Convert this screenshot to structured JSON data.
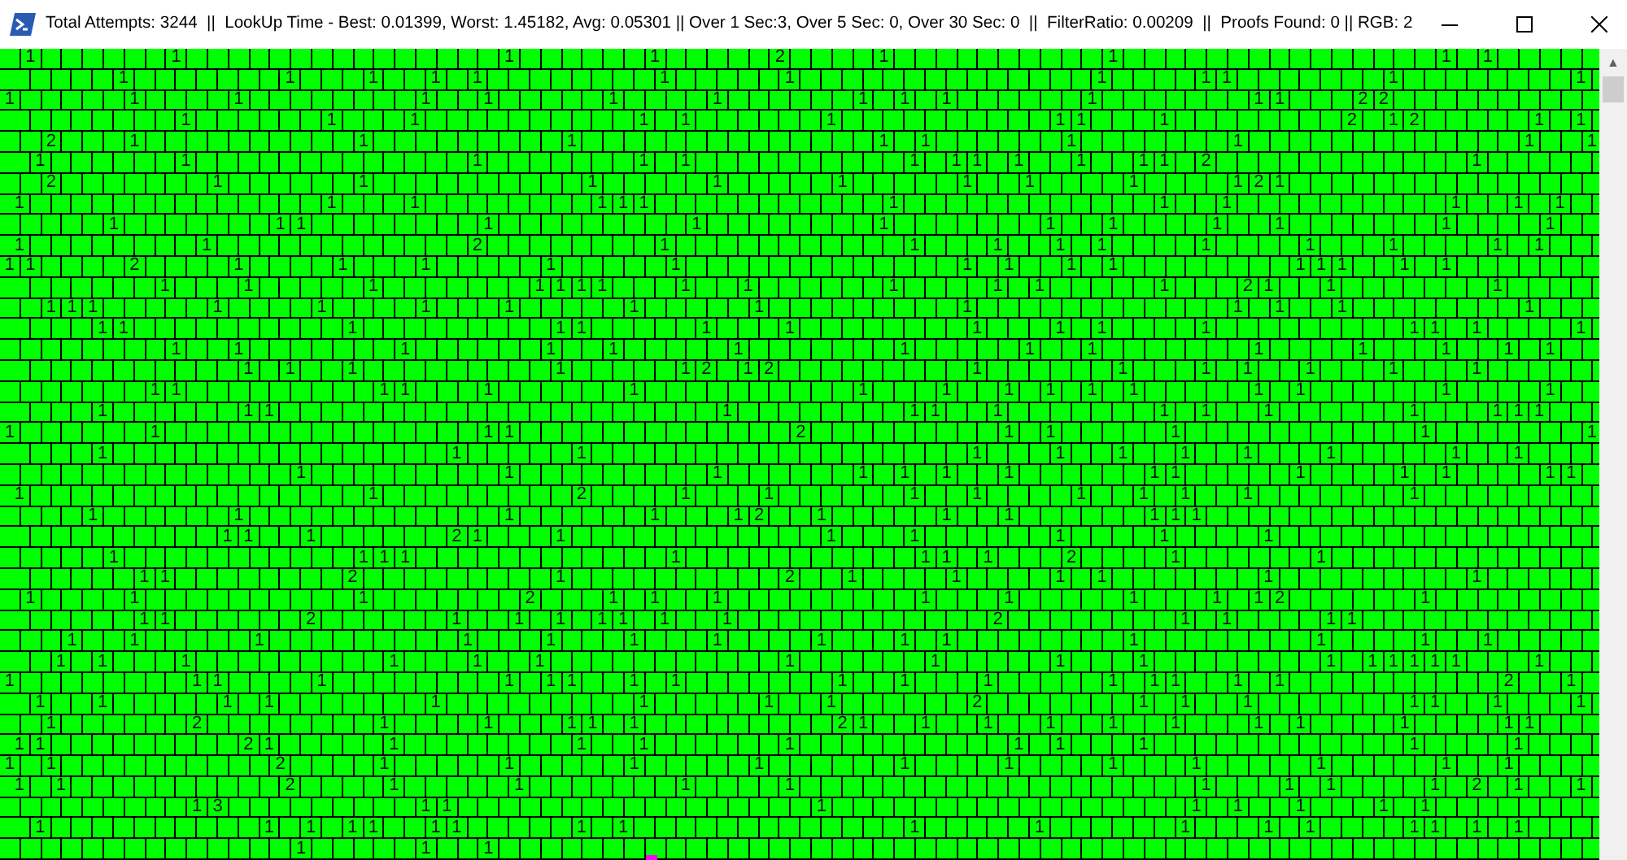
{
  "window": {
    "title": "Total Attempts: 3244  ||  LookUp Time - Best: 0.01399, Worst: 1.45182, Avg: 0.05301 || Over 1 Sec:3, Over 5 Sec: 0, Over 30 Sec: 0  ||  FilterRatio: 0.00209  ||  Proofs Found: 0 || RGB: 2"
  },
  "grid": {
    "rows": [
      [
        null,
        "1",
        null,
        null,
        null,
        null,
        null,
        null,
        "1",
        null,
        null,
        null,
        null,
        null,
        null,
        null,
        null,
        null,
        null,
        null,
        null,
        null,
        null,
        null,
        "1",
        null,
        null,
        null,
        null,
        null,
        null,
        "1",
        null,
        null,
        null,
        null,
        null,
        "2",
        null,
        null,
        null,
        null,
        "1",
        null,
        null,
        null,
        null,
        null,
        null,
        null,
        null,
        null,
        null,
        "1",
        null,
        null,
        null,
        null,
        null,
        null,
        null,
        null,
        null,
        null,
        null,
        null,
        null,
        null,
        null,
        "1",
        null,
        "1"
      ],
      [
        null,
        null,
        null,
        null,
        null,
        "1",
        null,
        null,
        null,
        null,
        null,
        null,
        null,
        "1",
        null,
        null,
        null,
        "1",
        null,
        null,
        "1",
        null,
        "1",
        null,
        null,
        null,
        null,
        null,
        null,
        null,
        null,
        "1",
        null,
        null,
        null,
        null,
        null,
        "1",
        null,
        null,
        null,
        null,
        null,
        null,
        null,
        null,
        null,
        null,
        null,
        null,
        null,
        null,
        "1",
        null,
        null,
        null,
        null,
        "1",
        "1",
        null,
        null,
        null,
        null,
        null,
        null,
        null,
        "1",
        null,
        null,
        null,
        null,
        null,
        null,
        null,
        null,
        "1"
      ],
      [
        "1",
        null,
        null,
        null,
        null,
        null,
        "1",
        null,
        null,
        null,
        null,
        "1",
        null,
        null,
        null,
        null,
        null,
        null,
        null,
        null,
        "1",
        null,
        null,
        "1",
        null,
        null,
        null,
        null,
        null,
        "1",
        null,
        null,
        null,
        null,
        "1",
        null,
        null,
        null,
        null,
        null,
        null,
        "1",
        null,
        "1",
        null,
        "1",
        null,
        null,
        null,
        null,
        null,
        null,
        "1",
        null,
        null,
        null,
        null,
        null,
        null,
        null,
        "1",
        "1",
        null,
        null,
        null,
        "2",
        "2"
      ],
      [
        null,
        null,
        null,
        null,
        null,
        null,
        null,
        null,
        "1",
        null,
        null,
        null,
        null,
        null,
        null,
        "1",
        null,
        null,
        null,
        "1",
        null,
        null,
        null,
        null,
        null,
        null,
        null,
        null,
        null,
        null,
        "1",
        null,
        "1",
        null,
        null,
        null,
        null,
        null,
        null,
        "1",
        null,
        null,
        null,
        null,
        null,
        null,
        null,
        null,
        null,
        null,
        "1",
        "1",
        null,
        null,
        null,
        "1",
        null,
        null,
        null,
        null,
        null,
        null,
        null,
        null,
        "2",
        null,
        "1",
        "2",
        null,
        null,
        null,
        null,
        null,
        "1",
        null,
        "1"
      ],
      [
        null,
        null,
        "2",
        null,
        null,
        null,
        "1",
        null,
        null,
        null,
        null,
        null,
        null,
        null,
        null,
        null,
        null,
        "1",
        null,
        null,
        null,
        null,
        null,
        null,
        null,
        null,
        null,
        "1",
        null,
        null,
        null,
        null,
        null,
        null,
        null,
        null,
        null,
        null,
        null,
        null,
        null,
        null,
        "1",
        null,
        "1",
        null,
        null,
        null,
        null,
        null,
        null,
        "1",
        null,
        null,
        null,
        null,
        null,
        null,
        null,
        "1",
        null,
        null,
        null,
        null,
        null,
        null,
        null,
        null,
        null,
        null,
        null,
        null,
        null,
        "1",
        null,
        null,
        "1"
      ],
      [
        null,
        "1",
        null,
        null,
        null,
        null,
        null,
        null,
        "1",
        null,
        null,
        null,
        null,
        null,
        null,
        null,
        null,
        null,
        null,
        null,
        null,
        null,
        "1",
        null,
        null,
        null,
        null,
        null,
        null,
        null,
        "1",
        null,
        "1",
        null,
        null,
        null,
        null,
        null,
        null,
        null,
        null,
        null,
        null,
        "1",
        null,
        "1",
        "1",
        null,
        "1",
        null,
        null,
        "1",
        null,
        null,
        "1",
        "1",
        null,
        "2",
        null,
        null,
        null,
        null,
        null,
        null,
        null,
        null,
        null,
        null,
        null,
        null,
        "1"
      ],
      [
        null,
        null,
        "2",
        null,
        null,
        null,
        null,
        null,
        null,
        null,
        "1",
        null,
        null,
        null,
        null,
        null,
        null,
        "1",
        null,
        null,
        null,
        null,
        null,
        null,
        null,
        null,
        null,
        null,
        "1",
        null,
        null,
        null,
        null,
        null,
        "1",
        null,
        null,
        null,
        null,
        null,
        "1",
        null,
        null,
        null,
        null,
        null,
        "1",
        null,
        null,
        "1",
        null,
        null,
        null,
        null,
        "1",
        null,
        null,
        null,
        null,
        "1",
        "2",
        "1"
      ],
      [
        "1",
        null,
        null,
        null,
        null,
        null,
        null,
        null,
        null,
        null,
        null,
        null,
        null,
        null,
        null,
        "1",
        null,
        null,
        null,
        "1",
        null,
        null,
        null,
        null,
        null,
        null,
        null,
        null,
        "1",
        "1",
        "1",
        null,
        null,
        null,
        null,
        null,
        null,
        null,
        null,
        null,
        null,
        null,
        "1",
        null,
        null,
        null,
        null,
        null,
        null,
        null,
        null,
        null,
        null,
        null,
        null,
        "1",
        null,
        null,
        "1",
        null,
        null,
        null,
        null,
        null,
        null,
        null,
        null,
        null,
        null,
        "1",
        null,
        null,
        "1",
        null,
        "1"
      ],
      [
        null,
        null,
        null,
        null,
        null,
        "1",
        null,
        null,
        null,
        null,
        null,
        null,
        null,
        "1",
        "1",
        null,
        null,
        null,
        null,
        null,
        null,
        null,
        null,
        "1",
        null,
        null,
        null,
        null,
        null,
        null,
        null,
        null,
        null,
        "1",
        null,
        null,
        null,
        null,
        null,
        null,
        null,
        null,
        "1",
        null,
        null,
        null,
        null,
        null,
        null,
        null,
        "1",
        null,
        null,
        "1",
        null,
        null,
        null,
        null,
        "1",
        null,
        null,
        "1",
        null,
        null,
        null,
        null,
        null,
        null,
        null,
        "1",
        null,
        null,
        null,
        null,
        "1"
      ],
      [
        "1",
        null,
        null,
        null,
        null,
        null,
        null,
        null,
        null,
        "1",
        null,
        null,
        null,
        null,
        null,
        null,
        null,
        null,
        null,
        null,
        null,
        null,
        "2",
        null,
        null,
        null,
        null,
        null,
        null,
        null,
        null,
        "1",
        null,
        null,
        null,
        null,
        null,
        null,
        null,
        null,
        null,
        null,
        null,
        "1",
        null,
        null,
        null,
        "1",
        null,
        null,
        "1",
        null,
        "1",
        null,
        null,
        null,
        null,
        "1",
        null,
        null,
        null,
        null,
        "1",
        null,
        null,
        null,
        "1",
        null,
        null,
        null,
        null,
        "1",
        null,
        "1"
      ],
      [
        "1",
        "1",
        null,
        null,
        null,
        null,
        "2",
        null,
        null,
        null,
        null,
        "1",
        null,
        null,
        null,
        null,
        "1",
        null,
        null,
        null,
        "1",
        null,
        null,
        null,
        null,
        null,
        "1",
        null,
        null,
        null,
        null,
        null,
        "1",
        null,
        null,
        null,
        null,
        null,
        null,
        null,
        null,
        null,
        null,
        null,
        null,
        null,
        "1",
        null,
        "1",
        null,
        null,
        "1",
        null,
        "1",
        null,
        null,
        null,
        null,
        null,
        null,
        null,
        null,
        "1",
        "1",
        "1",
        null,
        null,
        "1",
        null,
        "1"
      ],
      [
        null,
        null,
        null,
        null,
        null,
        null,
        null,
        "1",
        null,
        null,
        null,
        "1",
        null,
        null,
        null,
        null,
        null,
        "1",
        null,
        null,
        null,
        null,
        null,
        null,
        null,
        "1",
        "1",
        "1",
        "1",
        null,
        null,
        null,
        "1",
        null,
        null,
        "1",
        null,
        null,
        null,
        null,
        null,
        null,
        "1",
        null,
        null,
        null,
        null,
        "1",
        null,
        "1",
        null,
        null,
        null,
        null,
        null,
        "1",
        null,
        null,
        null,
        "2",
        "1",
        null,
        null,
        "1",
        null,
        null,
        null,
        null,
        null,
        null,
        null,
        "1"
      ],
      [
        null,
        null,
        "1",
        "1",
        "1",
        null,
        null,
        null,
        null,
        null,
        "1",
        null,
        null,
        null,
        null,
        "1",
        null,
        null,
        null,
        null,
        "1",
        null,
        null,
        null,
        "1",
        null,
        null,
        null,
        null,
        null,
        "1",
        null,
        null,
        null,
        null,
        null,
        "1",
        null,
        null,
        null,
        null,
        null,
        null,
        null,
        null,
        null,
        "1",
        null,
        null,
        null,
        null,
        null,
        null,
        null,
        null,
        null,
        null,
        null,
        null,
        "1",
        null,
        "1",
        null,
        null,
        "1",
        null,
        null,
        null,
        null,
        null,
        null,
        null,
        null,
        "1"
      ],
      [
        null,
        null,
        null,
        null,
        "1",
        "1",
        null,
        null,
        null,
        null,
        null,
        null,
        null,
        null,
        null,
        null,
        "1",
        null,
        null,
        null,
        null,
        null,
        null,
        null,
        null,
        null,
        "1",
        "1",
        null,
        null,
        null,
        null,
        null,
        "1",
        null,
        null,
        null,
        "1",
        null,
        null,
        null,
        null,
        null,
        null,
        null,
        null,
        "1",
        null,
        null,
        null,
        "1",
        null,
        "1",
        null,
        null,
        null,
        null,
        "1",
        null,
        null,
        null,
        null,
        null,
        null,
        null,
        null,
        null,
        "1",
        "1",
        null,
        "1",
        null,
        null,
        null,
        null,
        "1"
      ],
      [
        null,
        null,
        null,
        null,
        null,
        null,
        null,
        null,
        "1",
        null,
        null,
        "1",
        null,
        null,
        null,
        null,
        null,
        null,
        null,
        "1",
        null,
        null,
        null,
        null,
        null,
        null,
        "1",
        null,
        null,
        "1",
        null,
        null,
        null,
        null,
        null,
        "1",
        null,
        null,
        null,
        null,
        null,
        null,
        null,
        "1",
        null,
        null,
        null,
        null,
        null,
        "1",
        null,
        null,
        "1",
        null,
        null,
        null,
        null,
        null,
        null,
        null,
        "1",
        null,
        null,
        null,
        null,
        "1",
        null,
        null,
        null,
        "1",
        null,
        null,
        "1",
        null,
        "1"
      ],
      [
        null,
        null,
        null,
        null,
        null,
        null,
        null,
        null,
        null,
        null,
        null,
        "1",
        null,
        "1",
        null,
        null,
        "1",
        null,
        null,
        null,
        null,
        null,
        null,
        null,
        null,
        null,
        "1",
        null,
        null,
        null,
        null,
        null,
        "1",
        "2",
        null,
        "1",
        "2",
        null,
        null,
        null,
        null,
        null,
        null,
        null,
        null,
        null,
        "1",
        null,
        null,
        null,
        null,
        null,
        null,
        "1",
        null,
        null,
        null,
        "1",
        null,
        "1",
        null,
        null,
        "1",
        null,
        null,
        null,
        "1",
        null,
        null,
        null,
        "1"
      ],
      [
        null,
        null,
        null,
        null,
        null,
        null,
        null,
        "1",
        "1",
        null,
        null,
        null,
        null,
        null,
        null,
        null,
        null,
        null,
        "1",
        "1",
        null,
        null,
        null,
        "1",
        null,
        null,
        null,
        null,
        null,
        null,
        "1",
        null,
        null,
        null,
        null,
        null,
        null,
        null,
        null,
        null,
        null,
        "1",
        null,
        null,
        null,
        "1",
        null,
        null,
        "1",
        null,
        "1",
        null,
        "1",
        null,
        "1",
        null,
        null,
        null,
        null,
        null,
        "1",
        null,
        "1",
        null,
        null,
        null,
        null,
        null,
        null,
        "1",
        null,
        null,
        null,
        null,
        "1"
      ],
      [
        null,
        null,
        null,
        null,
        "1",
        null,
        null,
        null,
        null,
        null,
        null,
        "1",
        "1",
        null,
        null,
        null,
        null,
        null,
        null,
        null,
        null,
        null,
        null,
        null,
        null,
        null,
        null,
        null,
        null,
        null,
        null,
        null,
        null,
        null,
        "1",
        null,
        null,
        null,
        null,
        null,
        null,
        null,
        null,
        "1",
        "1",
        null,
        null,
        "1",
        null,
        null,
        null,
        null,
        null,
        null,
        null,
        "1",
        null,
        "1",
        null,
        null,
        "1",
        null,
        null,
        null,
        null,
        null,
        null,
        "1",
        null,
        null,
        null,
        "1",
        "1",
        "1"
      ],
      [
        "1",
        null,
        null,
        null,
        null,
        null,
        null,
        "1",
        null,
        null,
        null,
        null,
        null,
        null,
        null,
        null,
        null,
        null,
        null,
        null,
        null,
        null,
        null,
        "1",
        "1",
        null,
        null,
        null,
        null,
        null,
        null,
        null,
        null,
        null,
        null,
        null,
        null,
        null,
        "2",
        null,
        null,
        null,
        null,
        null,
        null,
        null,
        null,
        null,
        "1",
        null,
        "1",
        null,
        null,
        null,
        null,
        null,
        "1",
        null,
        null,
        null,
        null,
        null,
        null,
        null,
        null,
        null,
        null,
        null,
        "1",
        null,
        null,
        null,
        null,
        null,
        null,
        null,
        "1"
      ],
      [
        null,
        null,
        null,
        null,
        "1",
        null,
        null,
        null,
        null,
        null,
        null,
        null,
        null,
        null,
        null,
        null,
        null,
        null,
        null,
        null,
        null,
        "1",
        null,
        null,
        null,
        null,
        null,
        "1",
        null,
        null,
        null,
        null,
        null,
        null,
        null,
        null,
        null,
        null,
        null,
        null,
        null,
        null,
        null,
        null,
        null,
        null,
        "1",
        null,
        null,
        null,
        "1",
        null,
        null,
        "1",
        null,
        null,
        "1",
        null,
        null,
        "1",
        null,
        null,
        null,
        "1",
        null,
        null,
        null,
        null,
        null,
        "1",
        null,
        null,
        "1"
      ],
      [
        null,
        null,
        null,
        null,
        null,
        null,
        null,
        null,
        null,
        null,
        null,
        null,
        null,
        null,
        "1",
        null,
        null,
        null,
        null,
        null,
        null,
        null,
        null,
        null,
        "1",
        null,
        null,
        null,
        null,
        null,
        null,
        null,
        null,
        null,
        "1",
        null,
        null,
        null,
        null,
        null,
        null,
        "1",
        null,
        "1",
        null,
        "1",
        null,
        null,
        "1",
        null,
        null,
        null,
        null,
        null,
        null,
        "1",
        "1",
        null,
        null,
        null,
        null,
        null,
        "1",
        null,
        null,
        null,
        null,
        "1",
        null,
        "1",
        null,
        null,
        null,
        null,
        "1",
        "1"
      ],
      [
        "1",
        null,
        null,
        null,
        null,
        null,
        null,
        null,
        null,
        null,
        null,
        null,
        null,
        null,
        null,
        null,
        null,
        "1",
        null,
        null,
        null,
        null,
        null,
        null,
        null,
        null,
        null,
        "2",
        null,
        null,
        null,
        null,
        "1",
        null,
        null,
        null,
        "1",
        null,
        null,
        null,
        null,
        null,
        null,
        "1",
        null,
        null,
        "1",
        null,
        null,
        null,
        null,
        "1",
        null,
        null,
        "1",
        null,
        "1",
        null,
        null,
        "1",
        null,
        null,
        null,
        null,
        null,
        null,
        null,
        "1"
      ],
      [
        null,
        null,
        null,
        null,
        "1",
        null,
        null,
        null,
        null,
        null,
        null,
        "1",
        null,
        null,
        null,
        null,
        null,
        null,
        null,
        null,
        null,
        null,
        null,
        null,
        "1",
        null,
        null,
        null,
        null,
        null,
        null,
        "1",
        null,
        null,
        null,
        "1",
        "2",
        null,
        null,
        "1",
        null,
        null,
        null,
        null,
        null,
        "1",
        null,
        null,
        "1",
        null,
        null,
        null,
        null,
        null,
        null,
        "1",
        "1",
        "1"
      ],
      [
        null,
        null,
        null,
        null,
        null,
        null,
        null,
        null,
        null,
        null,
        "1",
        "1",
        null,
        null,
        "1",
        null,
        null,
        null,
        null,
        null,
        null,
        "2",
        "1",
        null,
        null,
        null,
        "1",
        null,
        null,
        null,
        null,
        null,
        null,
        null,
        null,
        null,
        null,
        null,
        null,
        "1",
        null,
        null,
        null,
        "1",
        null,
        null,
        null,
        null,
        null,
        null,
        "1",
        null,
        null,
        null,
        null,
        "1",
        null,
        null,
        null,
        null,
        "1"
      ],
      [
        null,
        null,
        null,
        null,
        null,
        "1",
        null,
        null,
        null,
        null,
        null,
        null,
        null,
        null,
        null,
        null,
        null,
        "1",
        "1",
        "1",
        null,
        null,
        null,
        null,
        null,
        null,
        null,
        null,
        null,
        null,
        null,
        null,
        "1",
        null,
        null,
        null,
        null,
        null,
        null,
        null,
        null,
        null,
        null,
        null,
        "1",
        "1",
        null,
        "1",
        null,
        null,
        null,
        "2",
        null,
        null,
        null,
        null,
        "1",
        null,
        null,
        null,
        null,
        null,
        null,
        "1"
      ],
      [
        null,
        null,
        null,
        null,
        null,
        null,
        "1",
        "1",
        null,
        null,
        null,
        null,
        null,
        null,
        null,
        null,
        "2",
        null,
        null,
        null,
        null,
        null,
        null,
        null,
        null,
        null,
        "1",
        null,
        null,
        null,
        null,
        null,
        null,
        null,
        null,
        null,
        null,
        "2",
        null,
        null,
        "1",
        null,
        null,
        null,
        null,
        "1",
        null,
        null,
        null,
        null,
        "1",
        null,
        "1",
        null,
        null,
        null,
        null,
        null,
        null,
        null,
        "1",
        null,
        null,
        null,
        null,
        null,
        null,
        null,
        null,
        null,
        "1"
      ],
      [
        null,
        "1",
        null,
        null,
        null,
        null,
        "1",
        null,
        null,
        null,
        null,
        null,
        null,
        null,
        null,
        null,
        null,
        "1",
        null,
        null,
        null,
        null,
        null,
        null,
        null,
        "2",
        null,
        null,
        null,
        "1",
        null,
        "1",
        null,
        null,
        "1",
        null,
        null,
        null,
        null,
        null,
        null,
        null,
        null,
        null,
        "1",
        null,
        null,
        null,
        "1",
        null,
        null,
        null,
        null,
        null,
        "1",
        null,
        null,
        null,
        "1",
        null,
        "1",
        "2",
        null,
        null,
        null,
        null,
        null,
        null,
        "1"
      ],
      [
        null,
        null,
        null,
        null,
        null,
        null,
        "1",
        "1",
        null,
        null,
        null,
        null,
        null,
        null,
        "2",
        null,
        null,
        null,
        null,
        null,
        null,
        "1",
        null,
        null,
        "1",
        null,
        "1",
        null,
        "1",
        "1",
        null,
        "1",
        null,
        null,
        "1",
        null,
        null,
        null,
        null,
        null,
        null,
        null,
        null,
        null,
        null,
        null,
        null,
        "2",
        null,
        null,
        null,
        null,
        null,
        null,
        null,
        null,
        "1",
        null,
        "1",
        null,
        null,
        null,
        null,
        "1",
        "1"
      ],
      [
        null,
        null,
        null,
        "1",
        null,
        null,
        "1",
        null,
        null,
        null,
        null,
        null,
        "1",
        null,
        null,
        null,
        null,
        null,
        null,
        null,
        null,
        null,
        "1",
        null,
        null,
        null,
        "1",
        null,
        null,
        null,
        "1",
        null,
        null,
        null,
        "1",
        null,
        null,
        null,
        null,
        "1",
        null,
        null,
        null,
        "1",
        null,
        "1",
        null,
        null,
        null,
        null,
        null,
        null,
        null,
        null,
        "1",
        null,
        null,
        null,
        null,
        null,
        null,
        null,
        null,
        "1",
        null,
        null,
        null,
        null,
        "1",
        null,
        null,
        "1"
      ],
      [
        null,
        null,
        "1",
        null,
        "1",
        null,
        null,
        null,
        "1",
        null,
        null,
        null,
        null,
        null,
        null,
        null,
        null,
        null,
        "1",
        null,
        null,
        null,
        "1",
        null,
        null,
        "1",
        null,
        null,
        null,
        null,
        null,
        null,
        null,
        null,
        null,
        null,
        null,
        "1",
        null,
        null,
        null,
        null,
        null,
        null,
        "1",
        null,
        null,
        null,
        null,
        null,
        "1",
        null,
        null,
        null,
        "1",
        null,
        null,
        null,
        null,
        null,
        null,
        null,
        null,
        "1",
        null,
        "1",
        "1",
        "1",
        "1",
        "1",
        null,
        null,
        null,
        "1"
      ],
      [
        "1",
        null,
        null,
        null,
        null,
        null,
        null,
        null,
        null,
        "1",
        "1",
        null,
        null,
        null,
        null,
        "1",
        null,
        null,
        null,
        null,
        null,
        null,
        null,
        null,
        "1",
        null,
        "1",
        "1",
        null,
        null,
        "1",
        null,
        "1",
        null,
        null,
        null,
        null,
        null,
        null,
        null,
        "1",
        null,
        null,
        "1",
        null,
        null,
        null,
        "1",
        null,
        null,
        null,
        null,
        null,
        "1",
        null,
        "1",
        "1",
        null,
        null,
        "1",
        null,
        "1",
        null,
        null,
        null,
        null,
        null,
        null,
        null,
        null,
        null,
        null,
        "2",
        null,
        null,
        "1"
      ],
      [
        null,
        "1",
        null,
        null,
        "1",
        null,
        null,
        null,
        null,
        null,
        "1",
        null,
        "1",
        null,
        null,
        null,
        null,
        null,
        null,
        null,
        "1",
        null,
        null,
        null,
        null,
        null,
        null,
        null,
        null,
        null,
        "1",
        null,
        null,
        null,
        null,
        null,
        "1",
        null,
        null,
        "1",
        null,
        null,
        null,
        null,
        null,
        null,
        "2",
        null,
        null,
        null,
        null,
        null,
        null,
        null,
        "1",
        null,
        "1",
        null,
        null,
        "1",
        null,
        null,
        null,
        null,
        null,
        null,
        null,
        "1",
        "1",
        null,
        null,
        "1",
        null,
        null,
        null,
        "1"
      ],
      [
        null,
        null,
        "1",
        null,
        null,
        null,
        null,
        null,
        null,
        "2",
        null,
        null,
        null,
        null,
        null,
        null,
        null,
        null,
        "1",
        null,
        null,
        null,
        null,
        "1",
        null,
        null,
        null,
        "1",
        "1",
        null,
        "1",
        null,
        null,
        null,
        null,
        null,
        null,
        null,
        null,
        null,
        "2",
        "1",
        null,
        null,
        "1",
        null,
        null,
        "1",
        null,
        null,
        "1",
        null,
        null,
        "1",
        null,
        null,
        "1",
        null,
        null,
        null,
        "1",
        null,
        "1",
        null,
        null,
        null,
        null,
        "1",
        null,
        null,
        null,
        null,
        "1",
        "1"
      ],
      [
        "1",
        "1",
        null,
        null,
        null,
        null,
        null,
        null,
        null,
        null,
        null,
        "2",
        "1",
        null,
        null,
        null,
        null,
        null,
        "1",
        null,
        null,
        null,
        null,
        null,
        null,
        null,
        null,
        "1",
        null,
        null,
        "1",
        null,
        null,
        null,
        null,
        null,
        null,
        "1",
        null,
        null,
        null,
        null,
        null,
        null,
        null,
        null,
        null,
        null,
        "1",
        null,
        "1",
        null,
        null,
        null,
        "1",
        null,
        null,
        null,
        null,
        null,
        null,
        null,
        null,
        null,
        null,
        null,
        null,
        "1",
        null,
        null,
        null,
        null,
        "1"
      ],
      [
        "1",
        null,
        "1",
        null,
        null,
        null,
        null,
        null,
        null,
        null,
        null,
        null,
        null,
        "2",
        null,
        null,
        null,
        null,
        "1",
        null,
        null,
        null,
        null,
        null,
        "1",
        null,
        null,
        null,
        null,
        null,
        "1",
        null,
        null,
        null,
        null,
        null,
        "1",
        null,
        null,
        null,
        null,
        null,
        null,
        "1",
        null,
        null,
        null,
        null,
        "1",
        null,
        null,
        null,
        null,
        "1",
        null,
        null,
        null,
        "1",
        null,
        null,
        null,
        null,
        null,
        "1",
        null,
        null,
        null,
        null,
        null,
        "1",
        null,
        null,
        "1"
      ],
      [
        "1",
        null,
        "1",
        null,
        null,
        null,
        null,
        null,
        null,
        null,
        null,
        null,
        null,
        "2",
        null,
        null,
        null,
        null,
        "1",
        null,
        null,
        null,
        null,
        null,
        "1",
        null,
        null,
        null,
        null,
        null,
        null,
        null,
        "1",
        null,
        null,
        null,
        null,
        "1",
        null,
        null,
        null,
        null,
        null,
        null,
        null,
        null,
        null,
        null,
        null,
        null,
        null,
        null,
        null,
        null,
        null,
        null,
        null,
        "1",
        null,
        null,
        null,
        "1",
        null,
        "1",
        null,
        null,
        null,
        null,
        "1",
        null,
        "2",
        null,
        "1",
        null,
        null,
        "1"
      ],
      [
        null,
        null,
        null,
        null,
        null,
        null,
        null,
        null,
        null,
        "1",
        "3",
        null,
        null,
        null,
        null,
        null,
        null,
        null,
        null,
        null,
        "1",
        "1",
        null,
        null,
        null,
        null,
        null,
        null,
        null,
        null,
        null,
        null,
        null,
        null,
        null,
        null,
        null,
        null,
        null,
        "1",
        null,
        null,
        null,
        null,
        null,
        null,
        null,
        null,
        null,
        null,
        null,
        null,
        null,
        null,
        null,
        null,
        null,
        "1",
        null,
        "1",
        null,
        null,
        "1",
        null,
        null,
        null,
        "1",
        null,
        "1"
      ],
      [
        null,
        "1",
        null,
        null,
        null,
        null,
        null,
        null,
        null,
        null,
        null,
        null,
        "1",
        null,
        "1",
        null,
        "1",
        "1",
        null,
        null,
        "1",
        "1",
        null,
        null,
        null,
        null,
        null,
        "1",
        null,
        "1",
        null,
        null,
        null,
        null,
        null,
        null,
        null,
        null,
        null,
        null,
        null,
        null,
        null,
        "1",
        null,
        null,
        null,
        null,
        null,
        "1",
        null,
        null,
        null,
        null,
        null,
        null,
        "1",
        null,
        null,
        null,
        "1",
        null,
        "1",
        null,
        null,
        null,
        null,
        "1",
        "1",
        null,
        "1",
        null,
        "1"
      ],
      [
        null,
        null,
        null,
        null,
        null,
        null,
        null,
        null,
        null,
        null,
        null,
        null,
        null,
        null,
        "1",
        null,
        null,
        null,
        null,
        null,
        "1",
        null,
        null,
        "1"
      ]
    ]
  },
  "scrollbar": {
    "up_arrow": "▲"
  }
}
